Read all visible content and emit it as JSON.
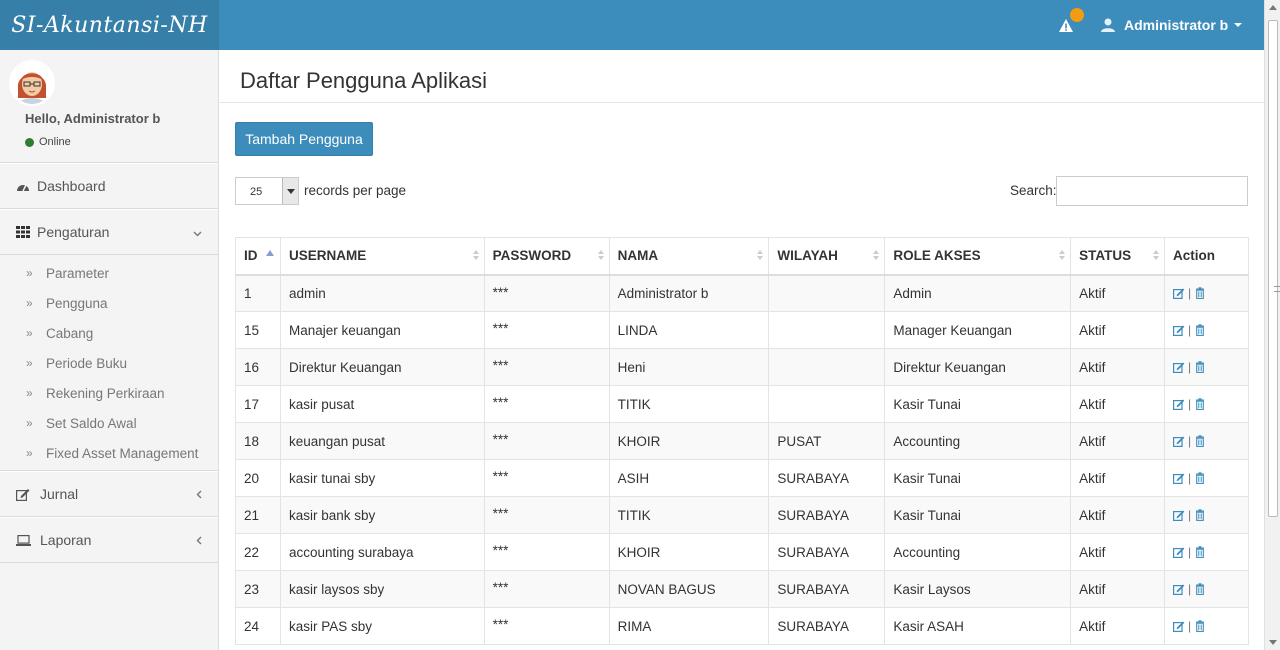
{
  "app": {
    "logo": "SI-Akuntansi-NH"
  },
  "header": {
    "user_name": "Administrator b",
    "notification_icon": "warning-icon",
    "accent": "#3c8dbc",
    "badge_color": "#f39c12"
  },
  "sidebar": {
    "hello": "Hello, Administrator b",
    "status": "Online",
    "menu": [
      {
        "label": "Dashboard",
        "icon": "dashboard-icon"
      },
      {
        "label": "Pengaturan",
        "icon": "grid-icon",
        "expanded": true
      },
      {
        "label": "Jurnal",
        "icon": "edit-icon"
      },
      {
        "label": "Laporan",
        "icon": "laptop-icon"
      }
    ],
    "submenu": [
      "Parameter",
      "Pengguna",
      "Cabang",
      "Periode Buku",
      "Rekening Perkiraan",
      "Set Saldo Awal",
      "Fixed Asset Management"
    ]
  },
  "page": {
    "title": "Daftar Pengguna Aplikasi",
    "add_button": "Tambah Pengguna",
    "page_length": "25",
    "records_label": "records per page",
    "search_label": "Search:",
    "search_value": ""
  },
  "table": {
    "headers": [
      "ID",
      "USERNAME",
      "PASSWORD",
      "NAMA",
      "WILAYAH",
      "ROLE AKSES",
      "STATUS",
      "Action"
    ],
    "rows": [
      [
        "1",
        "admin",
        "***",
        "Administrator b",
        "",
        "Admin",
        "Aktif"
      ],
      [
        "15",
        "Manajer keuangan",
        "***",
        "LINDA",
        "",
        "Manager Keuangan",
        "Aktif"
      ],
      [
        "16",
        "Direktur Keuangan",
        "***",
        "Heni",
        "",
        "Direktur Keuangan",
        "Aktif"
      ],
      [
        "17",
        "kasir pusat",
        "***",
        "TITIK",
        "",
        "Kasir Tunai",
        "Aktif"
      ],
      [
        "18",
        "keuangan pusat",
        "***",
        "KHOIR",
        "PUSAT",
        "Accounting",
        "Aktif"
      ],
      [
        "20",
        "kasir tunai sby",
        "***",
        "ASIH",
        "SURABAYA",
        "Kasir Tunai",
        "Aktif"
      ],
      [
        "21",
        "kasir bank sby",
        "***",
        "TITIK",
        "SURABAYA",
        "Kasir Tunai",
        "Aktif"
      ],
      [
        "22",
        "accounting surabaya",
        "***",
        "KHOIR",
        "SURABAYA",
        "Accounting",
        "Aktif"
      ],
      [
        "23",
        "kasir laysos sby",
        "***",
        "NOVAN BAGUS",
        "SURABAYA",
        "Kasir Laysos",
        "Aktif"
      ],
      [
        "24",
        "kasir PAS sby",
        "***",
        "RIMA",
        "SURABAYA",
        "Kasir ASAH",
        "Aktif"
      ]
    ],
    "action_separator": "|"
  }
}
